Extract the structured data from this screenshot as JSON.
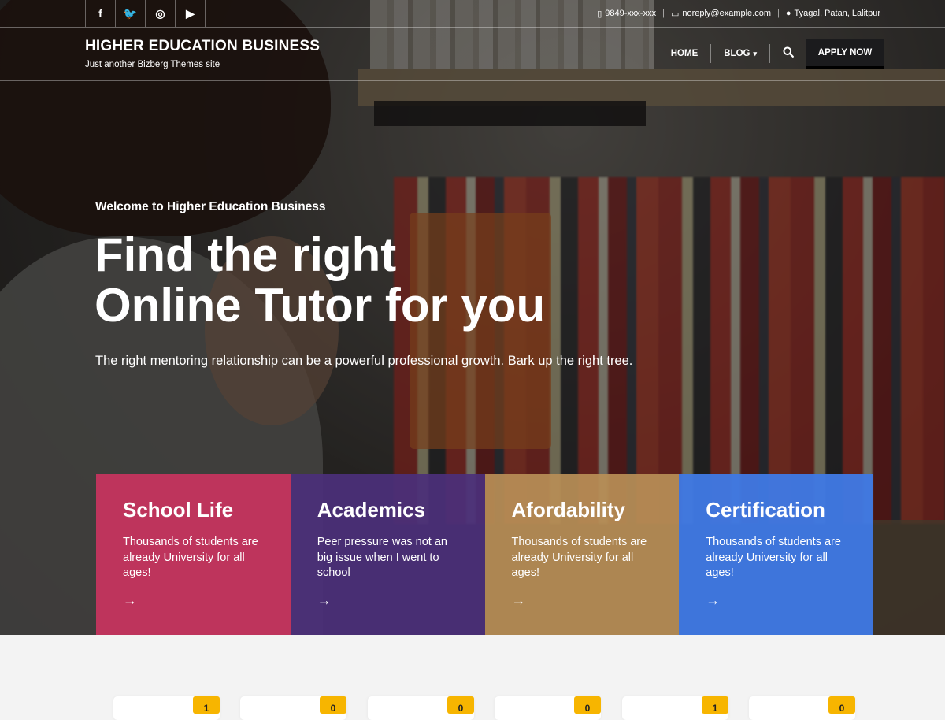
{
  "topbar": {
    "socials": [
      {
        "icon": "facebook-icon",
        "glyph": "f"
      },
      {
        "icon": "twitter-icon",
        "glyph": "🐦"
      },
      {
        "icon": "instagram-icon",
        "glyph": "◎"
      },
      {
        "icon": "youtube-icon",
        "glyph": "▶"
      }
    ],
    "phone": "9849-xxx-xxx",
    "email": "noreply@example.com",
    "address": "Tyagal, Patan, Lalitpur"
  },
  "header": {
    "site_title": "HIGHER EDUCATION BUSINESS",
    "tagline": "Just another Bizberg Themes site",
    "nav": {
      "home": "HOME",
      "blog": "BLOG",
      "apply": "APPLY NOW"
    }
  },
  "hero": {
    "welcome": "Welcome to Higher Education Business",
    "headline_line1": "Find the right",
    "headline_line2": "Online Tutor for you",
    "subtitle": "The right mentoring relationship can be a powerful professional growth. Bark up the right tree."
  },
  "cards": [
    {
      "title": "School Life",
      "text": "Thousands of students are already University for all ages!",
      "color": "#c8345f"
    },
    {
      "title": "Academics",
      "text": "Peer pressure was not an big issue when I went to school",
      "color": "#4b2f7a"
    },
    {
      "title": "Afordability",
      "text": "Thousands of students are already University for all ages!",
      "color": "#b88e56"
    },
    {
      "title": "Certification",
      "text": "Thousands of students are already University for all ages!",
      "color": "#3f79e3"
    }
  ],
  "stat_badges": [
    "1",
    "0",
    "0",
    "0",
    "1",
    "0"
  ],
  "colors": {
    "accent_badge": "#f7b500",
    "apply_button": "#1b1b1d"
  }
}
